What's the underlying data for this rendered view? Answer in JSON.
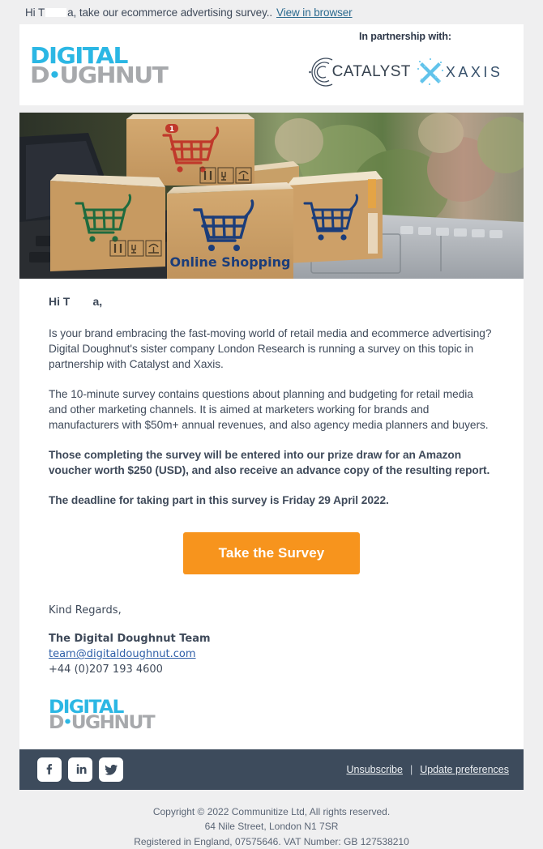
{
  "preheader": {
    "text_before": "Hi T",
    "text_after": "a, take our ecommerce advertising survey..",
    "view_in_browser": "View in browser"
  },
  "header": {
    "logo": {
      "line1": "DIGITAL",
      "line2_a": "D",
      "line2_dot": "•",
      "line2_b": "UGHNUT",
      "color_blue": "#2bb7e4",
      "color_gray": "#a7a9ac"
    },
    "partnership_label": "In partnership with:",
    "partner_catalyst": "CATALYST",
    "partner_xaxis": "XAXIS"
  },
  "hero": {
    "alt": "Cardboard boxes with shopping cart icons stacked on a laptop keyboard",
    "box_text": "Online Shopping",
    "badge": "1"
  },
  "body": {
    "greeting_before": "Hi T",
    "greeting_after": "a,",
    "paragraph_1": "Is your brand embracing the fast-moving world of retail media and ecommerce advertising? Digital Doughnut's sister company London Research is running a survey on this topic in partnership with Catalyst and Xaxis.",
    "paragraph_2": "The 10-minute survey contains questions about planning and budgeting for retail media and other marketing channels. It is aimed at marketers working for brands and manufacturers with $50m+ annual revenues, and also agency media planners and buyers.",
    "paragraph_3": "Those completing the survey will be entered into our prize draw for an Amazon voucher worth $250 (USD), and also receive an advance copy of the resulting report.",
    "paragraph_4": "The deadline for taking part in this survey is Friday 29 April 2022.",
    "cta_label": "Take the Survey",
    "kind_regards": "Kind Regards,",
    "team_name": "The Digital Doughnut Team",
    "team_email": "team@digitaldoughnut.com",
    "team_phone": "+44 (0)207 193 4600",
    "cta_color": "#f7941d"
  },
  "footer": {
    "social": [
      {
        "name": "facebook-icon",
        "label": "Facebook"
      },
      {
        "name": "linkedin-icon",
        "label": "LinkedIn"
      },
      {
        "name": "twitter-icon",
        "label": "Twitter"
      }
    ],
    "unsubscribe": "Unsubscribe",
    "separator": "|",
    "update_preferences": "Update preferences",
    "bar_color": "#3d4b5c"
  },
  "copyright": {
    "line1": "Copyright © 2022 Communitize Ltd, All rights reserved.",
    "line2": "64 Nile Street, London N1 7SR",
    "line3": "Registered in England, 07575646. VAT Number: GB 127538210"
  }
}
